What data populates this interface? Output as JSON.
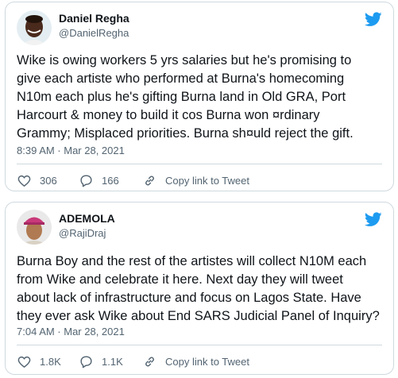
{
  "tweets": [
    {
      "author_name": "Daniel Regha",
      "handle": "@DanielRegha",
      "text_lines": [
        "Wike is owing workers 5 yrs salaries but he's promising to",
        "give each artiste who performed at Burna's homecoming",
        "N10m each plus he's gifting Burna land in Old GRA, Port",
        "Harcourt & money to build it cos Burna won ¤rdinary",
        "Grammy; Misplaced priorities. Burna sh¤uld reject the gift."
      ],
      "timestamp": "8:39 AM · Mar 28, 2021",
      "likes": "306",
      "replies": "166",
      "copy_link_label": "Copy link to Tweet",
      "like_icon": "heart-icon",
      "reply_icon": "speech-bubble-icon",
      "copy_icon": "link-icon"
    },
    {
      "author_name": "ADEMOLA",
      "handle": "@RajiDraj",
      "text_lines": [
        "Burna Boy and the rest of the artistes will collect N10M each",
        "from Wike and celebrate it here. Next day they will tweet",
        "about lack of infrastructure and focus on Lagos State. Have",
        "they ever ask Wike about End SARS Judicial Panel of Inquiry?"
      ],
      "timestamp": "7:04 AM · Mar 28, 2021",
      "likes": "1.8K",
      "replies": "1.1K",
      "copy_link_label": "Copy link to Tweet",
      "like_icon": "heart-icon",
      "reply_icon": "speech-bubble-icon",
      "copy_icon": "link-icon"
    }
  ],
  "colors": {
    "twitter_blue": "#1d9bf0",
    "text_primary": "#0f1419",
    "text_secondary": "#536471",
    "border": "#cfd9de"
  }
}
